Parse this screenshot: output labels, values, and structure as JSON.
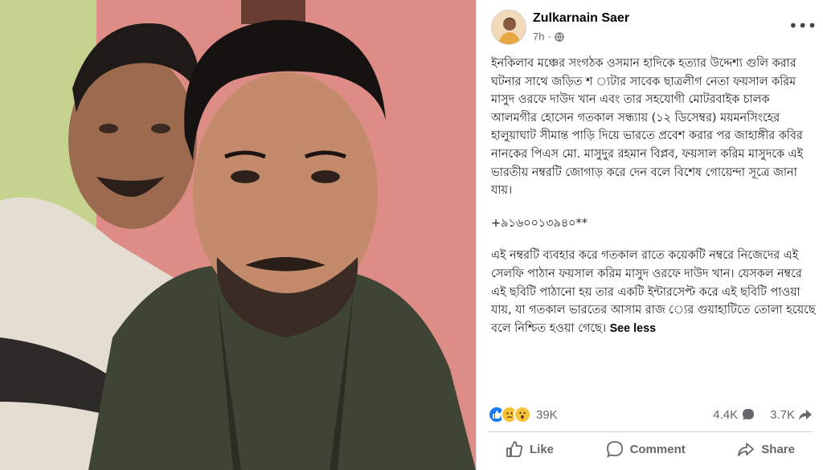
{
  "photo": {
    "description_icon": "selfie-photo"
  },
  "post": {
    "author": "Zulkarnain Saer",
    "time": "7h",
    "privacy_icon": "globe-icon",
    "more_label": "•••",
    "paragraphs": [
      "ইনকিলাব মঞ্চের সংগঠক ওসমান হাদিকে হত্যার উদ্দেশ্য গুলি করার ঘটনার সাথে জড়িত শ ্যটার সাবেক ছাত্রলীগ নেতা ফয়সাল করিম মাসুদ ওরফে দাউদ খান এবং তার সহযোগী মোটরবাইক চালক আলমগীর হোসেন গতকাল সন্ধ্যায় (১২ ডিসেম্বর) ময়মনসিংহের হালুয়াঘাট সীমান্ত পাড়ি দিয়ে ভারতে প্রবেশ করার পর জাহাঙ্গীর কবির নানকের পিএস মো. মাসুদুর রহমান বিপ্লব, ফয়সাল করিম মাসুদকে এই ভারতীয় নম্বরটি জোগাড় করে দেন বলে বিশেষ গোয়েন্দা সূত্রে জানা যায়।",
      "+৯১৬০০১৩৯৪০**",
      "এই নম্বরটি ব্যবহার করে গতকাল রাতে কয়েকটি নম্বরে নিজেদের এই সেলফি পাঠান ফয়সাল করিম মাসুদ ওরফে দাউদ খান। যেসকল নম্বরে এই ছবিটি পাঠানো হয় তার একটি ইন্টারসেপ্ট করে এই ছবিটি পাওয়া যায়, যা গতকাল ভারতের আসাম রাজ ্যের গুয়াহাটিতে তোলা হয়েছে বলে নিশ্চিত হওয়া গেছে।"
    ],
    "see_less": "See less"
  },
  "stats": {
    "reactions_count": "39K",
    "comments_count": "4.4K",
    "shares_count": "3.7K"
  },
  "actions": {
    "like": "Like",
    "comment": "Comment",
    "share": "Share"
  },
  "colors": {
    "like_blue": "#1877f2",
    "reaction_yellow": "#f7c33b",
    "muted_text": "#65676b"
  }
}
